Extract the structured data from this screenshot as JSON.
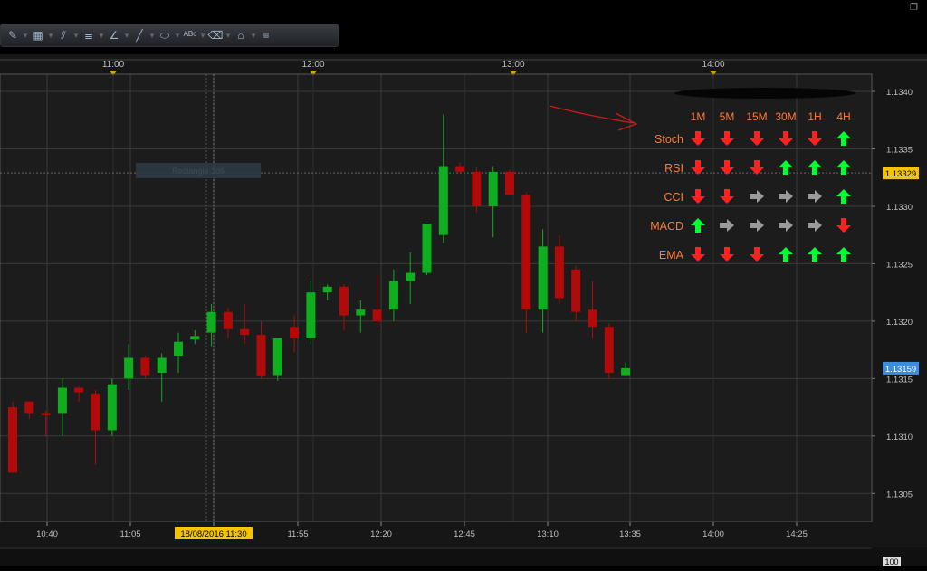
{
  "window": {
    "restore_icon": "restore-window-icon"
  },
  "toolbar": {
    "tools": [
      {
        "name": "ruler-tool-icon",
        "glyph": "✎"
      },
      {
        "name": "chart-type-icon",
        "glyph": "▦"
      },
      {
        "name": "fibonacci-tool-icon",
        "glyph": "⫽"
      },
      {
        "name": "list-tool-icon",
        "glyph": "≣"
      },
      {
        "name": "angle-tool-icon",
        "glyph": "∠"
      },
      {
        "name": "line-tool-icon",
        "glyph": "╱"
      },
      {
        "name": "ellipse-tool-icon",
        "glyph": "⬭"
      },
      {
        "name": "text-tool-icon",
        "glyph": "ᴬᴮᶜ"
      },
      {
        "name": "eraser-tool-icon",
        "glyph": "⌫"
      },
      {
        "name": "objects-tool-icon",
        "glyph": "⌂"
      },
      {
        "name": "toolbar-menu-icon",
        "glyph": "≡"
      }
    ]
  },
  "chart_data": {
    "type": "candlestick",
    "y_range": [
      1.13025,
      1.13415
    ],
    "y_ticks": [
      "1.1340",
      "1.1335",
      "1.1330",
      "1.1325",
      "1.1320",
      "1.1315",
      "1.1310",
      "1.1305"
    ],
    "x_ticks": [
      "10:40",
      "11:05",
      "11:30",
      "11:55",
      "12:20",
      "12:45",
      "13:10",
      "13:35",
      "14:00",
      "14:25"
    ],
    "top_time_labels": [
      "11:00",
      "12:00",
      "13:00",
      "14:00"
    ],
    "crosshair_time": "18/08/2016 11:30",
    "current_price": "1.13159",
    "crosshair_price": "1.13329",
    "rect_label": "Rectangle 3d6",
    "bottom_value": "100",
    "candles": [
      {
        "o": 1.13125,
        "h": 1.1313,
        "l": 1.1307,
        "c": 1.13068
      },
      {
        "o": 1.1313,
        "h": 1.1313,
        "l": 1.13115,
        "c": 1.1312
      },
      {
        "o": 1.1312,
        "h": 1.13122,
        "l": 1.131,
        "c": 1.13118
      },
      {
        "o": 1.1312,
        "h": 1.1315,
        "l": 1.131,
        "c": 1.13142
      },
      {
        "o": 1.13142,
        "h": 1.13143,
        "l": 1.1313,
        "c": 1.13138
      },
      {
        "o": 1.13137,
        "h": 1.1314,
        "l": 1.13075,
        "c": 1.13105
      },
      {
        "o": 1.13105,
        "h": 1.1315,
        "l": 1.131,
        "c": 1.13145
      },
      {
        "o": 1.1315,
        "h": 1.1318,
        "l": 1.1314,
        "c": 1.13168
      },
      {
        "o": 1.13168,
        "h": 1.1317,
        "l": 1.1315,
        "c": 1.13153
      },
      {
        "o": 1.13155,
        "h": 1.13172,
        "l": 1.1313,
        "c": 1.13168
      },
      {
        "o": 1.1317,
        "h": 1.1319,
        "l": 1.13155,
        "c": 1.13182
      },
      {
        "o": 1.13184,
        "h": 1.13192,
        "l": 1.1318,
        "c": 1.13187
      },
      {
        "o": 1.1319,
        "h": 1.13215,
        "l": 1.13178,
        "c": 1.13208
      },
      {
        "o": 1.13208,
        "h": 1.13212,
        "l": 1.13185,
        "c": 1.13193
      },
      {
        "o": 1.13193,
        "h": 1.13215,
        "l": 1.1318,
        "c": 1.13188
      },
      {
        "o": 1.13188,
        "h": 1.132,
        "l": 1.1315,
        "c": 1.13152
      },
      {
        "o": 1.13153,
        "h": 1.13185,
        "l": 1.13148,
        "c": 1.13185
      },
      {
        "o": 1.13195,
        "h": 1.13205,
        "l": 1.13173,
        "c": 1.13185
      },
      {
        "o": 1.13185,
        "h": 1.13235,
        "l": 1.1318,
        "c": 1.13225
      },
      {
        "o": 1.13225,
        "h": 1.13232,
        "l": 1.13218,
        "c": 1.1323
      },
      {
        "o": 1.1323,
        "h": 1.13232,
        "l": 1.13192,
        "c": 1.13205
      },
      {
        "o": 1.13205,
        "h": 1.13218,
        "l": 1.1319,
        "c": 1.1321
      },
      {
        "o": 1.1321,
        "h": 1.1324,
        "l": 1.13195,
        "c": 1.132
      },
      {
        "o": 1.1321,
        "h": 1.13245,
        "l": 1.132,
        "c": 1.13235
      },
      {
        "o": 1.13235,
        "h": 1.1326,
        "l": 1.13215,
        "c": 1.13242
      },
      {
        "o": 1.13242,
        "h": 1.13285,
        "l": 1.1324,
        "c": 1.13285
      },
      {
        "o": 1.13275,
        "h": 1.1338,
        "l": 1.13268,
        "c": 1.13335
      },
      {
        "o": 1.13335,
        "h": 1.13338,
        "l": 1.13328,
        "c": 1.1333
      },
      {
        "o": 1.1333,
        "h": 1.13334,
        "l": 1.13295,
        "c": 1.133
      },
      {
        "o": 1.133,
        "h": 1.13335,
        "l": 1.13273,
        "c": 1.1333
      },
      {
        "o": 1.1333,
        "h": 1.13332,
        "l": 1.1331,
        "c": 1.1331
      },
      {
        "o": 1.1331,
        "h": 1.13312,
        "l": 1.1319,
        "c": 1.1321
      },
      {
        "o": 1.1321,
        "h": 1.1328,
        "l": 1.1319,
        "c": 1.13265
      },
      {
        "o": 1.13265,
        "h": 1.13275,
        "l": 1.13215,
        "c": 1.1322
      },
      {
        "o": 1.13245,
        "h": 1.13248,
        "l": 1.132,
        "c": 1.13208
      },
      {
        "o": 1.1321,
        "h": 1.13235,
        "l": 1.13185,
        "c": 1.13195
      },
      {
        "o": 1.13195,
        "h": 1.13198,
        "l": 1.1315,
        "c": 1.13155
      },
      {
        "o": 1.13153,
        "h": 1.13164,
        "l": 1.13152,
        "c": 1.13159
      }
    ]
  },
  "signal_table": {
    "headers": [
      "1M",
      "5M",
      "15M",
      "30M",
      "1H",
      "4H"
    ],
    "rows": [
      {
        "label": "Stoch",
        "signals": [
          "down",
          "down",
          "down",
          "down",
          "down",
          "up"
        ]
      },
      {
        "label": "RSI",
        "signals": [
          "down",
          "down",
          "down",
          "up",
          "up",
          "up"
        ]
      },
      {
        "label": "CCI",
        "signals": [
          "down",
          "down",
          "flat",
          "flat",
          "flat",
          "up"
        ]
      },
      {
        "label": "MACD",
        "signals": [
          "up",
          "flat",
          "flat",
          "flat",
          "flat",
          "down"
        ]
      },
      {
        "label": "EMA",
        "signals": [
          "down",
          "down",
          "down",
          "up",
          "up",
          "up"
        ]
      }
    ],
    "colors": {
      "up": "#00ff33",
      "down": "#ff2020",
      "flat": "#9a9a9a",
      "label": "#ff7a33"
    }
  },
  "colors": {
    "bull": "#0fae1e",
    "bear": "#b00a0a",
    "grid": "#3a3a3a",
    "axis_text": "#bfbfbf",
    "bg": "#1c1c1c",
    "crosshair_price_bg": "#f5c400",
    "current_price_bg": "#3a8de0",
    "time_marker": "#d6a21a"
  }
}
